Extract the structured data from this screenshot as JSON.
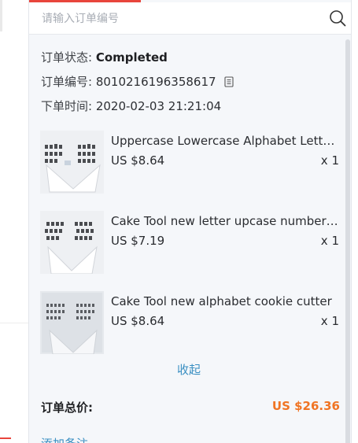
{
  "search": {
    "placeholder": "请输入订单编号"
  },
  "order": {
    "status_label": "订单状态:",
    "status_value": "Completed",
    "number_label": "订单编号:",
    "number_value": "8010216196358617",
    "time_label": "下单时间:",
    "time_value": "2020-02-03 21:21:04"
  },
  "items": [
    {
      "title": "Uppercase Lowercase Alphabet Letter Cookie Cutter",
      "price": "US $8.64",
      "qty": "x 1"
    },
    {
      "title": "Cake Tool new letter upcase number cookie cutter",
      "price": "US $7.19",
      "qty": "x 1"
    },
    {
      "title": "Cake Tool new alphabet cookie cutter",
      "price": "US $8.64",
      "qty": "x 1"
    }
  ],
  "collapse_label": "收起",
  "total": {
    "label": "订单总价:",
    "value": "US $26.36"
  },
  "add_note_label": "添加备注",
  "colors": {
    "accent": "#e8453c",
    "link": "#3a8fc2",
    "total": "#f07423"
  },
  "icons": {
    "search": "search-icon",
    "copy": "copy-icon"
  }
}
